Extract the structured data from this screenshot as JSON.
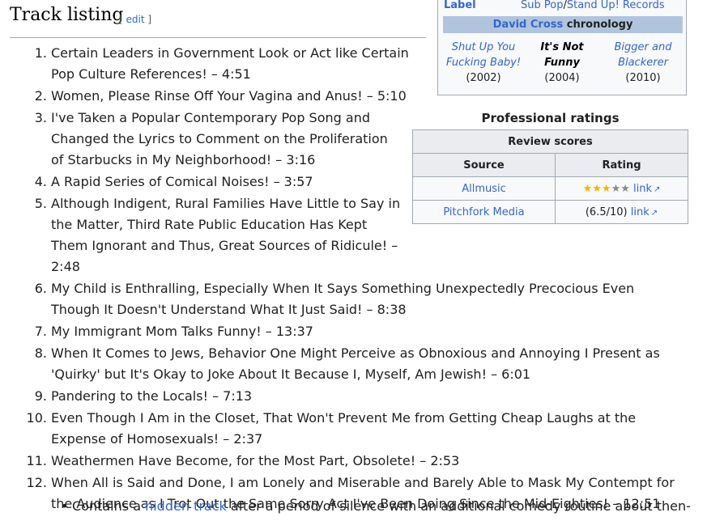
{
  "section": {
    "title": "Track listing",
    "edit_open": "[ ",
    "edit_link": "edit",
    "edit_close": " ]"
  },
  "infobox": {
    "label_key": "Label",
    "label_value_1": "Sub Pop",
    "label_sep": "/",
    "label_value_2": "Stand Up! Records",
    "chronology_artist": "David Cross",
    "chronology_word": "chronology",
    "previous": {
      "title": "Shut Up You Fucking Baby!",
      "year": "(2002)"
    },
    "current": {
      "title": "It's Not Funny",
      "year": "(2004)"
    },
    "next": {
      "title": "Bigger and Blackerer",
      "year": "(2010)"
    }
  },
  "ratings": {
    "title": "Professional ratings",
    "table_caption": "Review scores",
    "col_source": "Source",
    "col_rating": "Rating",
    "rows": [
      {
        "source": "Allmusic",
        "stars_filled": 3,
        "stars_total": 5,
        "stars_on": "★★★",
        "stars_off": "★★",
        "score": "",
        "link": "link"
      },
      {
        "source": "Pitchfork Media",
        "score": "(6.5/10)",
        "link": "link"
      }
    ]
  },
  "tracks": [
    {
      "num": "1.",
      "text": "Certain Leaders in Government Look or Act like Certain Pop Culture References! – 4:51"
    },
    {
      "num": "2.",
      "text": "Women, Please Rinse Off Your Vagina and Anus! – 5:10"
    },
    {
      "num": "3.",
      "text": "I've Taken a Popular Contemporary Pop Song and Changed the Lyrics to Comment on the Proliferation of Starbucks in My Neighborhood! – 3:16"
    },
    {
      "num": "4.",
      "text": "A Rapid Series of Comical Noises! – 3:57"
    },
    {
      "num": "5.",
      "text": "Although Indigent, Rural Families Have Little to Say in the Matter, Third Rate Public Education Has Kept Them Ignorant and Thus, Great Sources of Ridicule! – 2:48"
    },
    {
      "num": "6.",
      "text": "My Child is Enthralling, Especially When It Says Something Unexpectedly Precocious Even Though It Doesn't Understand What It Just Said! – 8:38"
    },
    {
      "num": "7.",
      "text": "My Immigrant Mom Talks Funny! – 13:37"
    },
    {
      "num": "8.",
      "text": "When It Comes to Jews, Behavior One Might Perceive as Obnoxious and Annoying I Present as 'Quirky' but It's Okay to Joke About It Because I, Myself, Am Jewish! – 6:01"
    },
    {
      "num": "9.",
      "text": "Pandering to the Locals! – 7:13"
    },
    {
      "num": "10.",
      "text": "Even Though I Am in the Closet, That Won't Prevent Me from Getting Cheap Laughs at the Expense of Homosexuals! – 2:37"
    },
    {
      "num": "11.",
      "text": "Weathermen Have Become, for the Most Part, Obsolete! – 2:53"
    },
    {
      "num": "12.",
      "text": "When All is Said and Done, I am Lonely and Miserable and Barely Able to Mask My Contempt for the Audience as I Trot Out the Same Sorry Act I've Been Doing Since the Mid-Eighties! – 12:51"
    }
  ],
  "note": {
    "prefix": "Contains a ",
    "link": "hidden track",
    "suffix": " after a period of silence with an additional comedy routine about then-"
  }
}
